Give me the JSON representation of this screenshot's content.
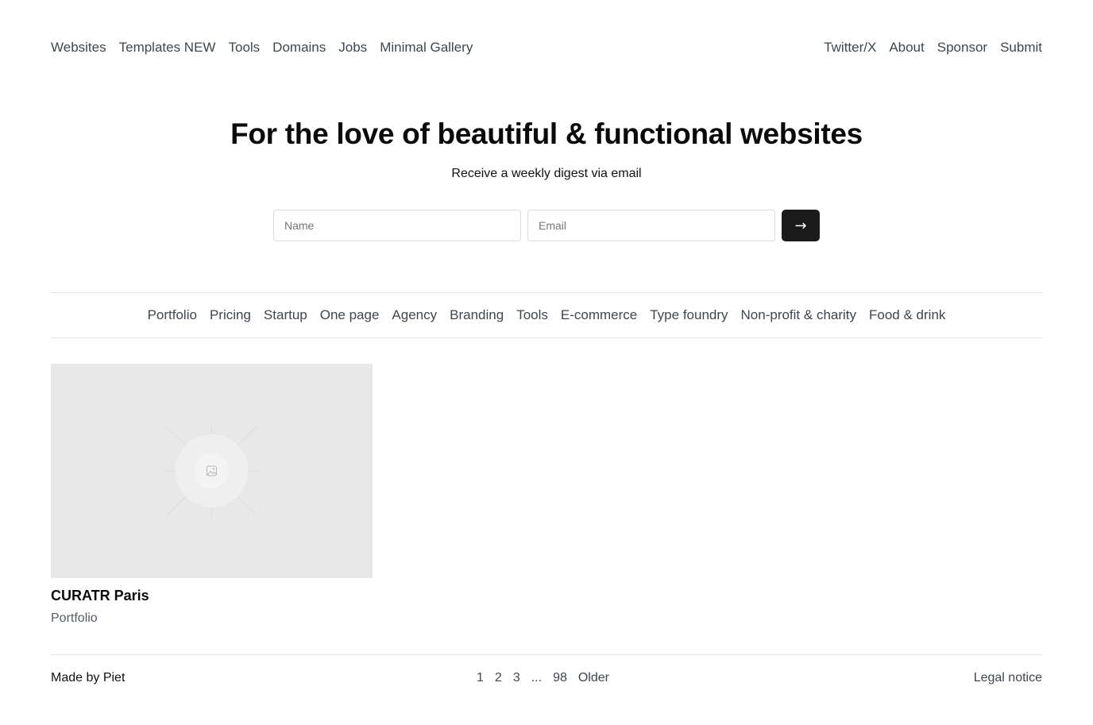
{
  "nav": {
    "left": [
      "Websites",
      "Templates NEW",
      "Tools",
      "Domains",
      "Jobs",
      "Minimal Gallery"
    ],
    "right": [
      "Twitter/X",
      "About",
      "Sponsor",
      "Submit"
    ]
  },
  "hero": {
    "title": "For the love of beautiful & functional websites",
    "subtitle": "Receive a weekly digest via email",
    "name_placeholder": "Name",
    "email_placeholder": "Email",
    "submit_glyph": "→"
  },
  "categories": [
    "Portfolio",
    "Pricing",
    "Startup",
    "One page",
    "Agency",
    "Branding",
    "Tools",
    "E-commerce",
    "Type foundry",
    "Non-profit & charity",
    "Food & drink"
  ],
  "card": {
    "title": "CURATR Paris",
    "category": "Portfolio",
    "thumbnail_icon": "image-placeholder-icon"
  },
  "footer": {
    "made_by": "Made by Piet",
    "pages": [
      "1",
      "2",
      "3",
      "...",
      "98",
      "Older"
    ],
    "legal": "Legal notice"
  }
}
